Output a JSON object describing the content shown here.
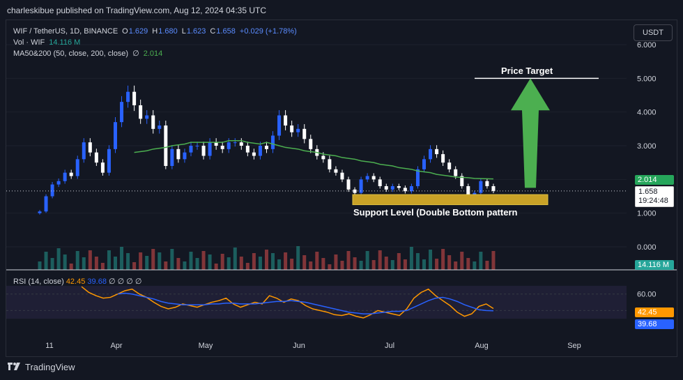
{
  "publisher_line": "charleskibue published on TradingView.com, Aug 12, 2024 04:35 UTC",
  "legend": {
    "symbol": "WIF / TetherUS, 1D, BINANCE",
    "o_label": "O",
    "o_value": "1.629",
    "h_label": "H",
    "h_value": "1.680",
    "l_label": "L",
    "l_value": "1.623",
    "c_label": "C",
    "c_value": "1.658",
    "change": "+0.029 (+1.78%)",
    "vol_label": "Vol · WIF",
    "vol_value": "14.116 M",
    "ma_label": "MA50&200 (50, close, 200, close)",
    "ma_symbol": "∅",
    "ma_value": "2.014"
  },
  "currency_button": "USDT",
  "price_axis": [
    "6.000",
    "5.000",
    "4.000",
    "3.000",
    "2.000",
    "1.000",
    "0.000"
  ],
  "tags": {
    "ma": "2.014",
    "price": "1.658",
    "countdown": "19:24:48",
    "volume": "14.116 M",
    "rsi": "42.45",
    "rsi_ma": "39.68"
  },
  "rsi_legend": {
    "label": "RSI (14, close)",
    "v1": "42.45",
    "v2": "39.68",
    "rest": "∅ ∅ ∅ ∅"
  },
  "rsi_axis": [
    "60.00",
    "40.00"
  ],
  "time_axis": [
    "11",
    "Apr",
    "May",
    "Jun",
    "Jul",
    "Aug",
    "Sep"
  ],
  "annotations": {
    "target": "Price Target",
    "support": "Support Level (Double Bottom pattern"
  },
  "footer_brand": "TradingView",
  "colors": {
    "up": "#26a69a",
    "down": "#ef5350",
    "ma": "#4caf50",
    "rsi": "#ff9800",
    "rsi_ma": "#2962ff",
    "support_zone": "#c9a227",
    "arrow": "#4caf50"
  },
  "chart_data": {
    "type": "candlestick",
    "title": "WIF / TetherUS, 1D, BINANCE",
    "ylim": [
      0,
      6
    ],
    "x_ticks": [
      "11",
      "Apr",
      "May",
      "Jun",
      "Jul",
      "Aug",
      "Sep"
    ],
    "close_series": [
      1.05,
      1.5,
      1.85,
      1.95,
      2.2,
      2.1,
      2.6,
      3.1,
      2.8,
      2.5,
      2.2,
      2.9,
      3.7,
      4.3,
      4.6,
      4.2,
      3.8,
      3.9,
      3.5,
      3.6,
      2.4,
      2.9,
      2.6,
      2.8,
      3.0,
      3.0,
      2.7,
      3.1,
      3.0,
      2.9,
      3.1,
      3.1,
      3.0,
      2.8,
      2.7,
      3.0,
      2.9,
      3.3,
      3.9,
      3.6,
      3.4,
      3.5,
      3.2,
      2.9,
      2.7,
      2.6,
      2.3,
      2.2,
      2.0,
      1.7,
      1.6,
      2.0,
      2.1,
      2.0,
      1.8,
      1.7,
      1.8,
      1.75,
      1.65,
      1.8,
      2.3,
      2.6,
      2.9,
      2.75,
      2.5,
      2.3,
      2.1,
      1.8,
      1.45,
      1.6,
      1.95,
      1.8,
      1.658
    ],
    "ma50_series": [
      null,
      null,
      null,
      null,
      null,
      null,
      null,
      null,
      null,
      null,
      2.8,
      2.85,
      2.9,
      2.95,
      3.0,
      3.05,
      3.1,
      3.1,
      3.1,
      3.1,
      3.15,
      3.15,
      3.1,
      3.05,
      3.1,
      3.0,
      2.95,
      2.9,
      2.85,
      2.8,
      2.75,
      2.7,
      2.65,
      2.6,
      2.55,
      2.5,
      2.45,
      2.4,
      2.35,
      2.3,
      2.25,
      2.2,
      2.15,
      2.1,
      2.07,
      2.05,
      2.03,
      2.02,
      2.014
    ],
    "ma_value": 2.014,
    "last_price": 1.658,
    "support_zone": [
      1.25,
      1.55
    ],
    "price_target": 5.0,
    "volume_last": "14.116 M",
    "rsi_series": [
      69,
      62,
      58,
      55,
      56,
      60,
      64,
      66,
      60,
      56,
      50,
      45,
      42,
      44,
      48,
      46,
      44,
      47,
      50,
      52,
      55,
      48,
      44,
      47,
      50,
      48,
      58,
      55,
      50,
      54,
      52,
      46,
      42,
      40,
      38,
      35,
      34,
      36,
      33,
      31,
      35,
      40,
      38,
      36,
      34,
      42,
      55,
      62,
      66,
      58,
      52,
      46,
      38,
      33,
      36,
      45,
      48,
      42.45
    ],
    "rsi_ma_series": [
      null,
      null,
      null,
      null,
      null,
      60,
      61,
      60,
      58,
      56,
      54,
      51,
      49,
      48,
      47,
      47,
      47,
      47,
      48,
      48,
      49,
      49,
      48,
      48,
      48,
      49,
      50,
      51,
      51,
      52,
      51,
      50,
      48,
      46,
      44,
      42,
      40,
      38,
      37,
      36,
      36,
      37,
      38,
      39,
      39,
      40,
      44,
      48,
      52,
      55,
      56,
      54,
      51,
      47,
      44,
      41,
      40,
      39.68
    ],
    "rsi_ylim": [
      20,
      75
    ],
    "annotations": [
      "Price Target",
      "Support Level (Double Bottom pattern"
    ]
  }
}
